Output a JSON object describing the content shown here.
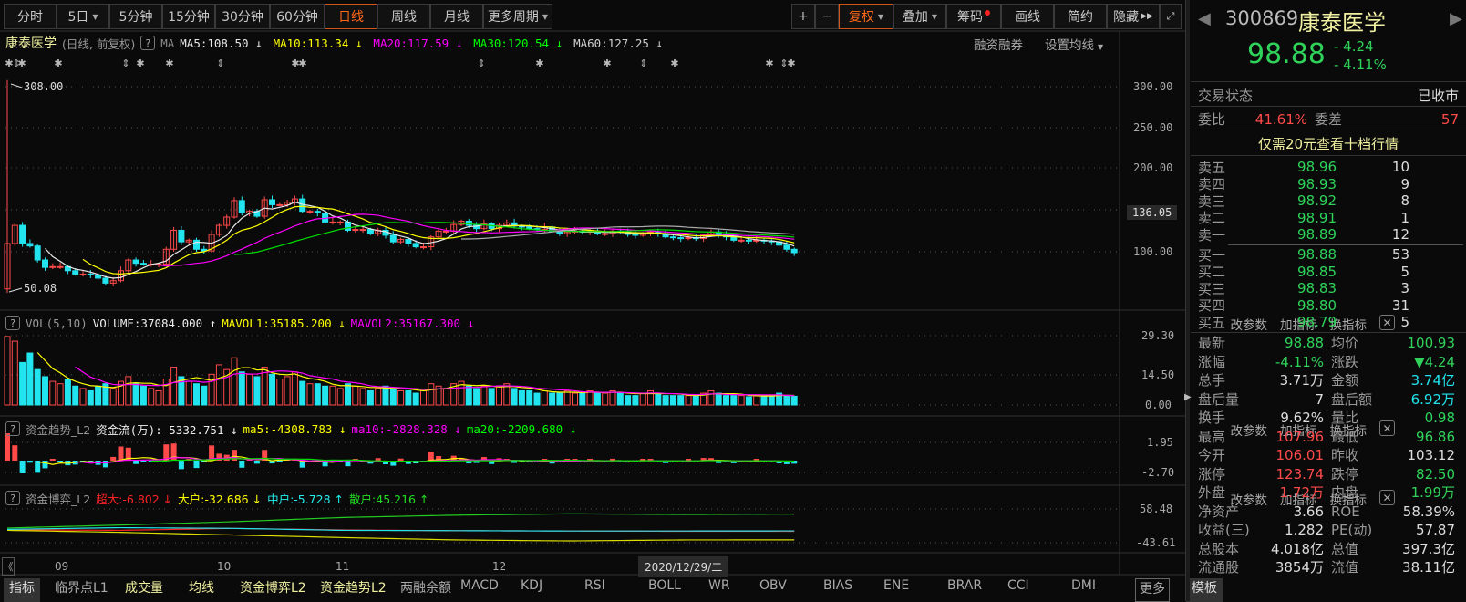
{
  "toolbar": {
    "periods": [
      "分时",
      "5日",
      "5分钟",
      "15分钟",
      "30分钟",
      "60分钟",
      "日线",
      "周线",
      "月线",
      "更多周期"
    ],
    "active": "日线",
    "zoom_in": "+",
    "zoom_out": "−",
    "fuquan": "复权",
    "overlay": "叠加",
    "chips": "筹码",
    "draw": "画线",
    "simple": "简约",
    "hide": "隐藏"
  },
  "main": {
    "title": "康泰医学",
    "subtitle": "(日线, 前复权)",
    "help": "?",
    "ma_label": "MA",
    "ma": [
      {
        "t": "MA5:108.50 ↓",
        "color": "#e8e8e8"
      },
      {
        "t": "MA10:113.34 ↓",
        "color": "#ffff00"
      },
      {
        "t": "MA20:117.59 ↓",
        "color": "#ff00ff"
      },
      {
        "t": "MA30:120.54 ↓",
        "color": "#00ff00"
      },
      {
        "t": "MA60:127.25 ↓",
        "color": "#d0d0d0"
      }
    ],
    "margin": "融资融券",
    "set_ma": "设置均线",
    "max_label": "308.00",
    "min_label": "50.08",
    "axis": [
      "300.00",
      "250.00",
      "200.00",
      "136.05",
      "100.00"
    ]
  },
  "volume": {
    "help": "?",
    "name": "VOL(5,10)",
    "v": "VOLUME:37084.000 ↑",
    "m1": "MAVOL1:35185.200 ↓",
    "m2": "MAVOL2:35167.300 ↓",
    "axis": [
      "29.30",
      "14.50",
      "0.00"
    ]
  },
  "fund": {
    "help": "?",
    "name": "资金趋势_L2",
    "v": "资金流(万):-5332.751 ↓",
    "m5": "ma5:-4308.783 ↓",
    "m10": "ma10:-2828.328 ↓",
    "m20": "ma20:-2209.680 ↓",
    "axis": [
      "1.95",
      "-2.70"
    ]
  },
  "game": {
    "help": "?",
    "name": "资金博弈_L2",
    "a": "超大:-6.802 ↓",
    "b": "大户:-32.686 ↓",
    "c": "中户:-5.728 ↑",
    "d": "散户:45.216 ↑",
    "axis": [
      "58.48",
      "-43.61"
    ],
    "lines": {
      "super": [
        -2,
        -4,
        2,
        -3,
        -5,
        -6,
        -7,
        -6.8
      ],
      "big": [
        -4,
        -10,
        -18,
        -26,
        -33,
        -36,
        -33,
        -32.7
      ],
      "mid": [
        -1,
        4,
        2,
        -4,
        -5,
        -6,
        -6,
        -5.7
      ],
      "retail": [
        3,
        12,
        22,
        35,
        42,
        46,
        44,
        45.2
      ]
    }
  },
  "panel_actions": {
    "params": "改参数",
    "add": "加指标",
    "swap": "换指标",
    "close": "✕"
  },
  "dates": {
    "ticks": [
      "09",
      "10",
      "11",
      "12"
    ],
    "cursor": "2020/12/29/二",
    "prev": "《"
  },
  "bottom_tabs": [
    "指标",
    "临界点L1",
    "成交量",
    "均线",
    "资金博弈L2",
    "资金趋势L2",
    "两融余额",
    "MACD",
    "KDJ",
    "RSI",
    "BOLL",
    "WR",
    "OBV",
    "BIAS",
    "ENE",
    "BRAR",
    "CCI",
    "DMI",
    "更多",
    "模板"
  ],
  "quote": {
    "code": "300869",
    "name": "康泰医学",
    "price": "98.88",
    "change": "- 4.24",
    "pct": "- 4.11%",
    "status_label": "交易状态",
    "status": "已收市",
    "wb_label": "委比",
    "wb": "41.61%",
    "wc_label": "委差",
    "wc": "57",
    "promo": "仅需20元查看十档行情",
    "asks": [
      [
        "卖五",
        "98.96",
        "10"
      ],
      [
        "卖四",
        "98.93",
        "9"
      ],
      [
        "卖三",
        "98.92",
        "8"
      ],
      [
        "卖二",
        "98.91",
        "1"
      ],
      [
        "卖一",
        "98.89",
        "12"
      ]
    ],
    "bids": [
      [
        "买一",
        "98.88",
        "53"
      ],
      [
        "买二",
        "98.85",
        "5"
      ],
      [
        "买三",
        "98.83",
        "3"
      ],
      [
        "买四",
        "98.80",
        "31"
      ],
      [
        "买五",
        "98.79",
        "5"
      ]
    ],
    "stats": [
      [
        "最新",
        "98.88",
        "g",
        "均价",
        "100.93",
        "g"
      ],
      [
        "涨幅",
        "-4.11%",
        "g",
        "涨跌",
        "▼4.24",
        "g"
      ],
      [
        "总手",
        "3.71万",
        "w",
        "金额",
        "3.74亿",
        "c"
      ],
      [
        "盘后量",
        "7",
        "w",
        "盘后额",
        "6.92万",
        "c"
      ],
      [
        "换手",
        "9.62%",
        "w",
        "量比",
        "0.98",
        "g"
      ],
      [
        "最高",
        "107.96",
        "r",
        "最低",
        "96.86",
        "g"
      ],
      [
        "今开",
        "106.01",
        "r",
        "昨收",
        "103.12",
        "w"
      ],
      [
        "涨停",
        "123.74",
        "r",
        "跌停",
        "82.50",
        "g"
      ],
      [
        "外盘",
        "1.72万",
        "r",
        "内盘",
        "1.99万",
        "g"
      ],
      [
        "净资产",
        "3.66",
        "w",
        "ROE",
        "58.39%",
        "w"
      ],
      [
        "收益(三)",
        "1.282",
        "w",
        "PE(动)",
        "57.87",
        "w"
      ],
      [
        "总股本",
        "4.018亿",
        "w",
        "总值",
        "397.3亿",
        "w"
      ],
      [
        "流通股",
        "3854万",
        "w",
        "流值",
        "38.11亿",
        "w"
      ]
    ]
  },
  "series": {
    "first_open": 55,
    "first_high": 308,
    "first_low": 50.08,
    "closes": [
      110,
      132,
      110,
      107,
      90,
      81,
      82,
      82,
      77,
      73,
      73,
      72,
      68,
      62,
      65,
      77,
      90,
      86,
      85,
      85,
      85,
      103,
      126,
      112,
      114,
      103,
      101,
      121,
      132,
      142,
      162,
      147,
      149,
      143,
      163,
      157,
      157,
      160,
      164,
      149,
      149,
      147,
      136,
      136,
      136,
      126,
      127,
      127,
      122,
      126,
      120,
      112,
      115,
      110,
      106,
      106,
      118,
      125,
      125,
      133,
      137,
      132,
      128,
      134,
      128,
      132,
      135,
      131,
      130,
      128,
      127,
      130,
      125,
      122,
      124,
      125,
      124,
      125,
      122,
      122,
      125,
      124,
      121,
      120,
      122,
      124,
      122,
      118,
      117,
      116,
      117,
      116,
      120,
      124,
      120,
      118,
      114,
      114,
      113,
      114,
      113,
      112,
      108,
      103,
      98.88
    ],
    "volumes": [
      29,
      27,
      18,
      22,
      15,
      12,
      10,
      9,
      11,
      8,
      7,
      6,
      8,
      9,
      7,
      10,
      12,
      9,
      8,
      7,
      6,
      11,
      16,
      12,
      10,
      9,
      8,
      13,
      17,
      15,
      20,
      14,
      13,
      12,
      16,
      13,
      11,
      12,
      14,
      10,
      9,
      9,
      8,
      8,
      7,
      9,
      8,
      7,
      6,
      7,
      8,
      7,
      6,
      6,
      5,
      6,
      9,
      8,
      7,
      9,
      10,
      8,
      7,
      8,
      7,
      8,
      9,
      7,
      6,
      6,
      5,
      6,
      5,
      5,
      6,
      5,
      5,
      6,
      5,
      5,
      6,
      5,
      4,
      4,
      5,
      6,
      5,
      4,
      4,
      4,
      4,
      4,
      5,
      6,
      5,
      4,
      4,
      4,
      3.5,
      4,
      3.5,
      4,
      5,
      4,
      3.7
    ]
  },
  "colors": {
    "up": "#ff4a4a",
    "down": "#22e4ee",
    "ma5": "#e8e8e8",
    "ma10": "#ffff00",
    "ma20": "#ff00ff",
    "ma30": "#00dd00",
    "ma60": "#aaaaaa"
  }
}
